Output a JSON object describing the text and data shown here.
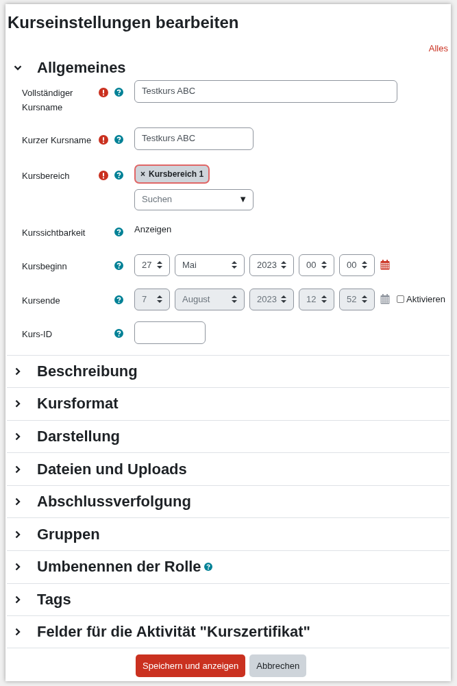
{
  "title": "Kurseinstellungen bearbeiten",
  "expand_all": "Alles",
  "sections": [
    {
      "title": "Allgemeines",
      "expanded": true,
      "help": false,
      "fields": [
        {
          "kind": "text",
          "label": "Vollständiger Kursname",
          "required": true,
          "help": true,
          "value": "Testkurs ABC"
        },
        {
          "kind": "text",
          "label": "Kurzer Kursname",
          "required": true,
          "help": true,
          "value": "Testkurs ABC"
        },
        {
          "kind": "autocomplete",
          "label": "Kursbereich",
          "required": true,
          "help": true,
          "chips": [
            {
              "remove": "×",
              "label": "Kursbereich 1"
            }
          ],
          "placeholder": "Suchen",
          "arrow": "▼"
        },
        {
          "kind": "static",
          "label": "Kurssichtbarkeit",
          "required": false,
          "help": true,
          "value": "Anzeigen"
        },
        {
          "kind": "date",
          "label": "Kursbeginn",
          "required": false,
          "help": true,
          "disabled": false,
          "parts": [
            "27",
            "Mai",
            "2023",
            "00",
            "00"
          ]
        },
        {
          "kind": "date",
          "label": "Kursende",
          "required": false,
          "help": true,
          "disabled": true,
          "parts": [
            "7",
            "August",
            "2023",
            "12",
            "52"
          ],
          "enable": {
            "label": "Aktivieren",
            "checked": false
          }
        },
        {
          "kind": "text",
          "label": "Kurs-ID",
          "required": false,
          "help": true
        }
      ]
    },
    {
      "title": "Beschreibung",
      "expanded": false,
      "help": false
    },
    {
      "title": "Kursformat",
      "expanded": false,
      "help": false
    },
    {
      "title": "Darstellung",
      "expanded": false,
      "help": false
    },
    {
      "title": "Dateien und Uploads",
      "expanded": false,
      "help": false
    },
    {
      "title": "Abschlussverfolgung",
      "expanded": false,
      "help": false
    },
    {
      "title": "Gruppen",
      "expanded": false,
      "help": false
    },
    {
      "title": "Umbenennen der Rolle",
      "expanded": false,
      "help": true
    },
    {
      "title": "Tags",
      "expanded": false,
      "help": false
    },
    {
      "title": "Felder für die Aktivität \"Kurszertifikat\"",
      "expanded": false,
      "help": false
    }
  ],
  "buttons": [
    {
      "label": "Speichern und anzeigen",
      "kind": "primary"
    },
    {
      "label": "Abbrechen",
      "kind": "secondary"
    }
  ]
}
